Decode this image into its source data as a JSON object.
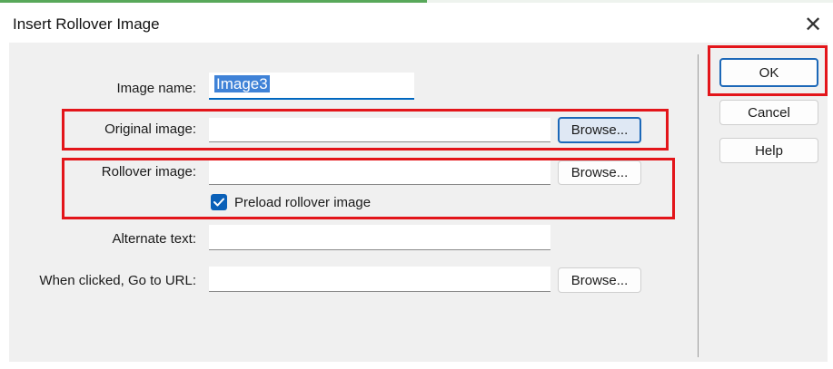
{
  "window": {
    "title": "Insert Rollover Image"
  },
  "form": {
    "image_name": {
      "label": "Image name:",
      "value": "Image3"
    },
    "original_image": {
      "label": "Original image:",
      "value": "",
      "browse_label": "Browse..."
    },
    "rollover_image": {
      "label": "Rollover image:",
      "value": "",
      "browse_label": "Browse..."
    },
    "preload": {
      "label": "Preload rollover image",
      "checked": true
    },
    "alternate_text": {
      "label": "Alternate text:",
      "value": ""
    },
    "goto_url": {
      "label": "When clicked, Go to URL:",
      "value": "",
      "browse_label": "Browse..."
    }
  },
  "buttons": {
    "ok": "OK",
    "cancel": "Cancel",
    "help": "Help"
  },
  "icons": {
    "close": "close-icon",
    "check": "checkmark-icon"
  },
  "colors": {
    "highlight": "#e3151a",
    "accent": "#0067c0",
    "selection": "#3f82d7"
  }
}
